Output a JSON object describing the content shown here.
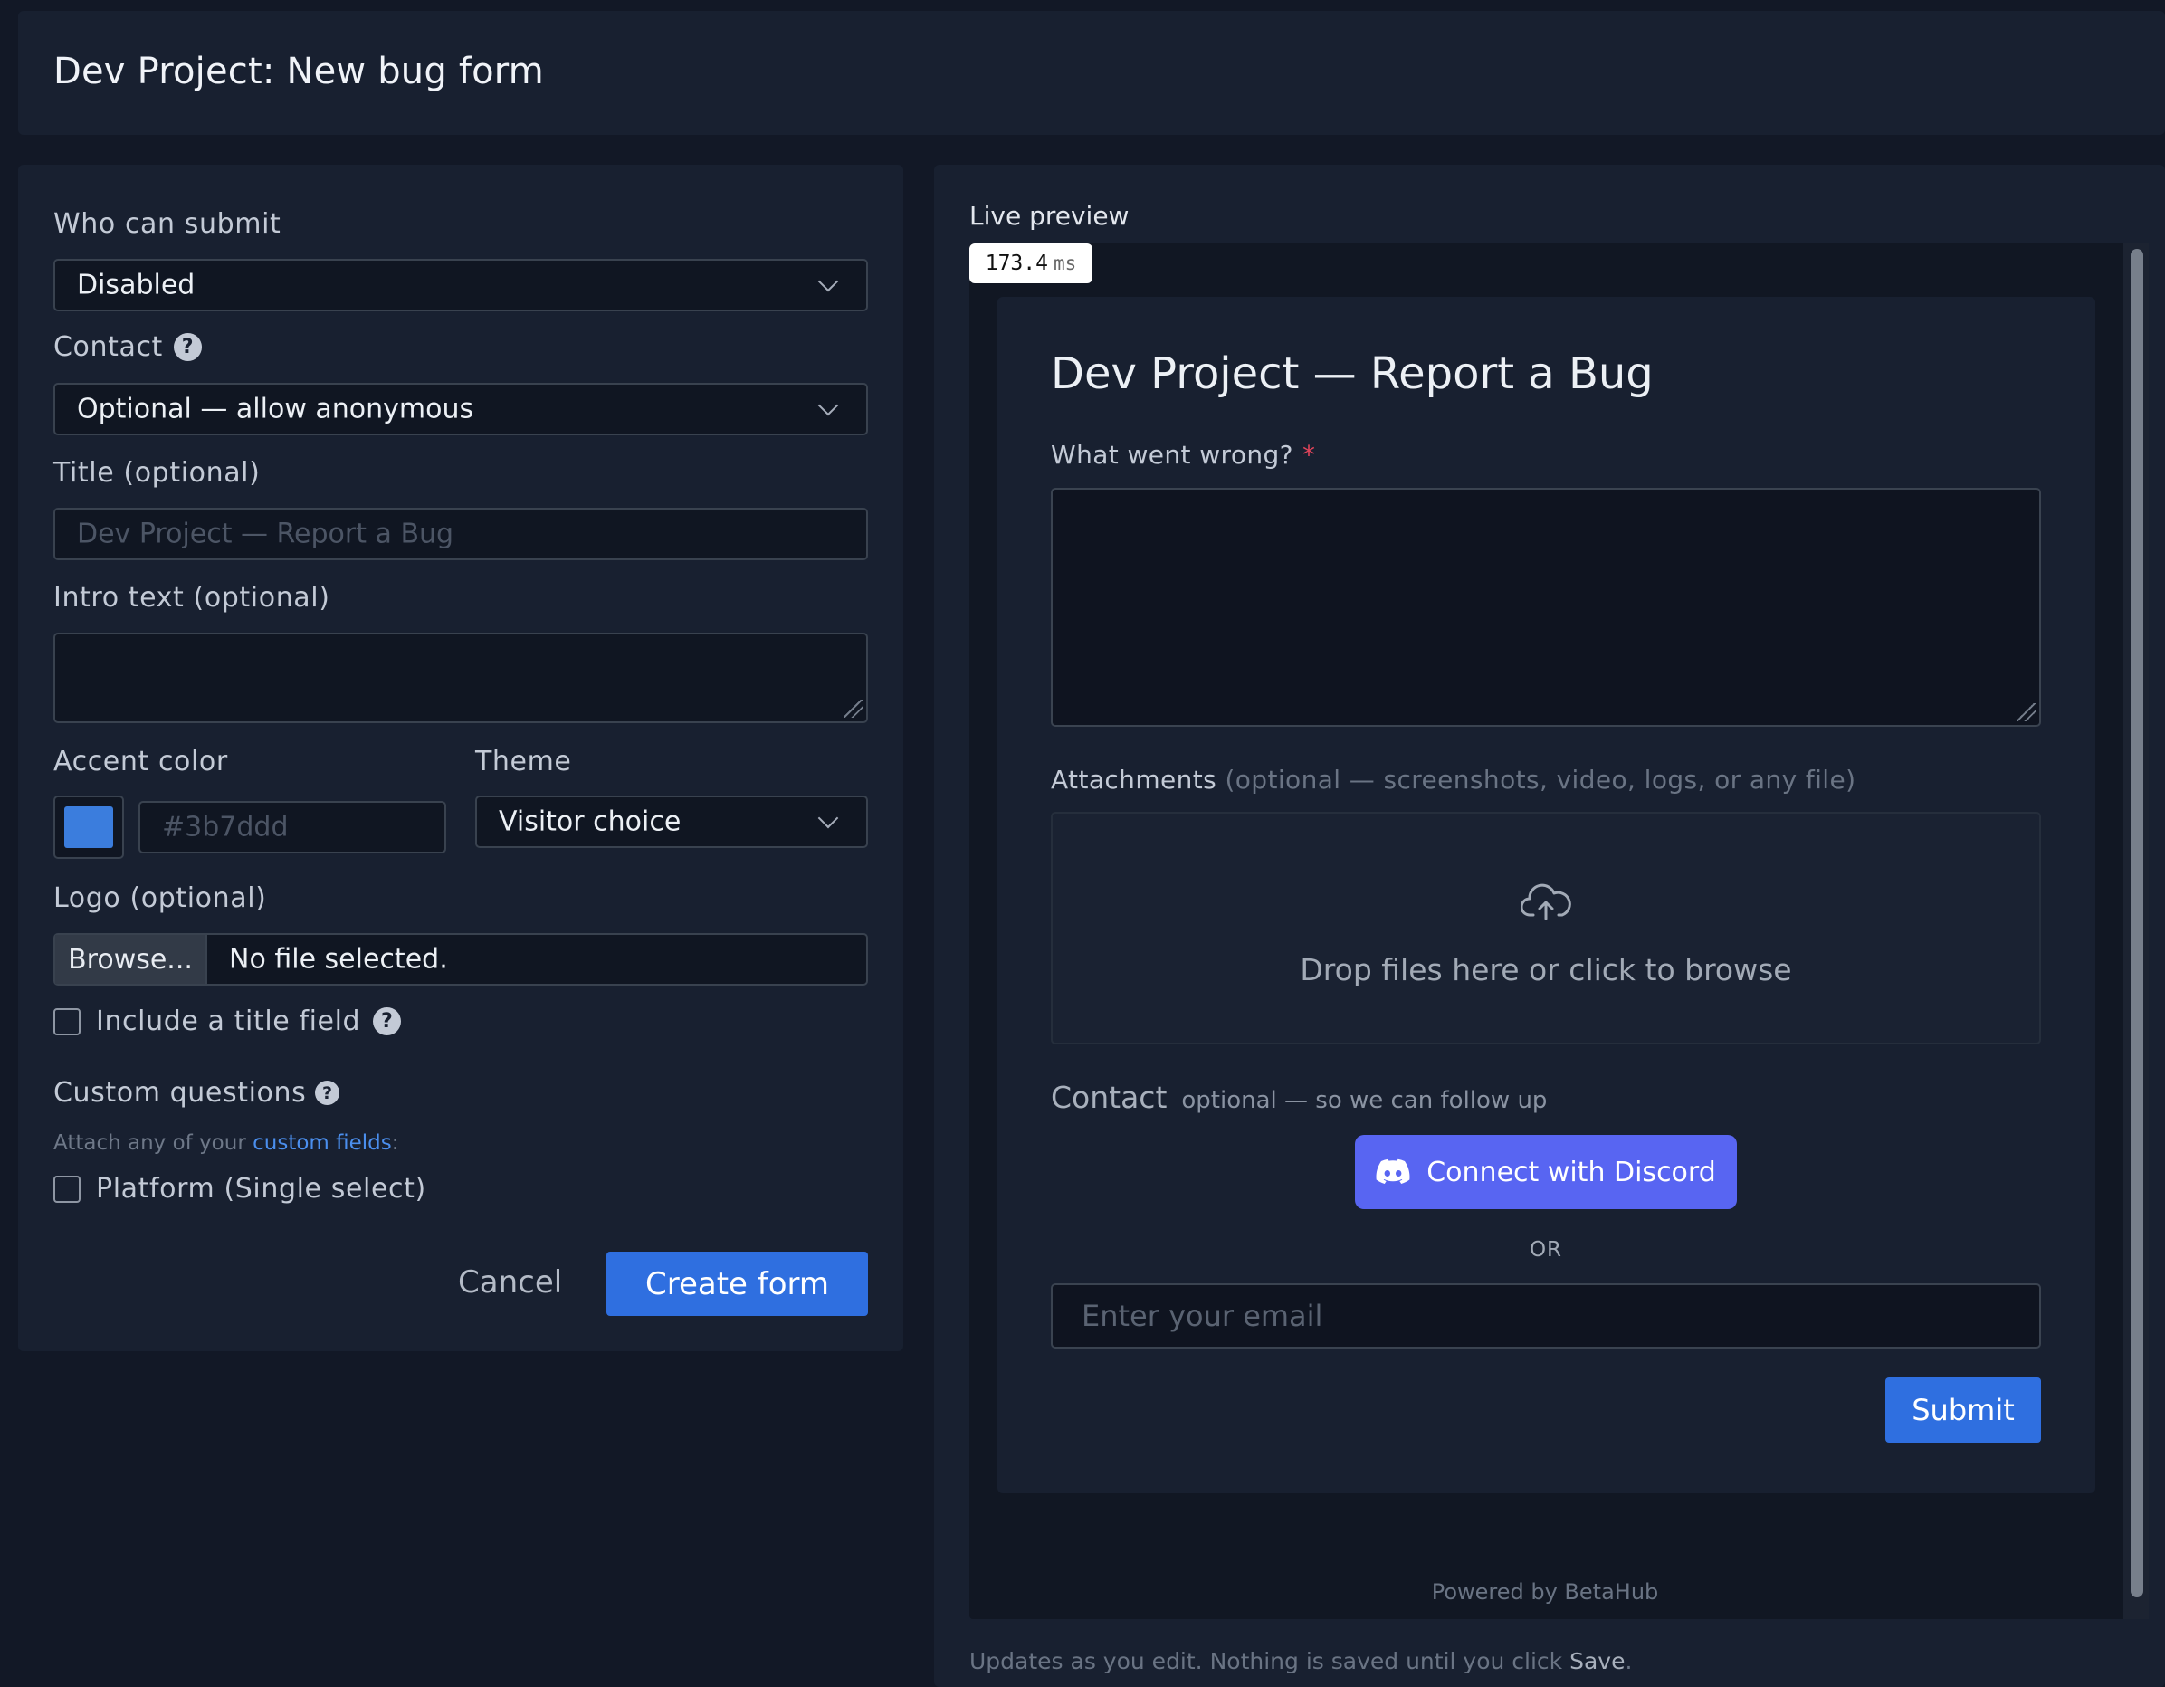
{
  "header": {
    "title": "Dev Project: New bug form"
  },
  "form": {
    "who_label": "Who can submit",
    "who_value": "Disabled",
    "contact_label": "Contact",
    "contact_value": "Optional — allow anonymous",
    "title_label": "Title (optional)",
    "title_placeholder": "Dev Project — Report a Bug",
    "intro_label": "Intro text (optional)",
    "accent_label": "Accent color",
    "accent_color": "#3b7ddd",
    "accent_placeholder": "#3b7ddd",
    "theme_label": "Theme",
    "theme_value": "Visitor choice",
    "logo_label": "Logo (optional)",
    "browse_label": "Browse...",
    "file_status": "No file selected.",
    "include_title_label": "Include a title field",
    "custom_questions_label": "Custom questions",
    "attach_text": "Attach any of your",
    "custom_fields_link": "custom fields",
    "attach_suffix": ":",
    "platform_label": "Platform (Single select)",
    "cancel_label": "Cancel",
    "create_label": "Create form"
  },
  "preview": {
    "label": "Live preview",
    "timing_value": "173.4",
    "timing_unit": "ms",
    "title": "Dev Project — Report a Bug",
    "what_label": "What went wrong?",
    "required_mark": "*",
    "attachments_label": "Attachments",
    "attachments_hint": "(optional — screenshots, video, logs, or any file)",
    "drop_text": "Drop files here or click to browse",
    "contact_label": "Contact",
    "contact_hint": "optional — so we can follow up",
    "discord_label": "Connect with Discord",
    "or_text": "OR",
    "email_placeholder": "Enter your email",
    "submit_label": "Submit",
    "powered_by": "Powered by BetaHub"
  },
  "footer": {
    "note_prefix": "Updates as you edit. Nothing is saved until you click",
    "note_save": "Save",
    "note_suffix": "."
  },
  "colors": {
    "background": "#121826",
    "panel": "#182030",
    "primary": "#2f6fe0",
    "discord": "#5865f2",
    "required": "#e0445a",
    "link": "#4b8fee"
  }
}
